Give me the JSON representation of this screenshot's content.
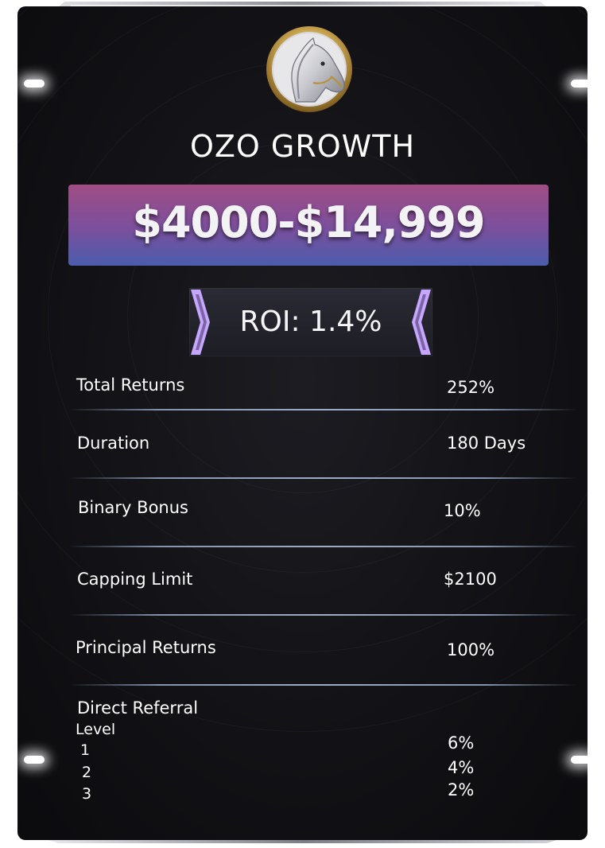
{
  "logo_alt": "horse-head-emblem",
  "title": "OZO GROWTH",
  "price_range": "$4000-$14,999",
  "roi": "ROI: 1.4%",
  "rows": [
    {
      "label": "Total Returns",
      "value": "252%"
    },
    {
      "label": "Duration",
      "value": "180 Days"
    },
    {
      "label": "Binary Bonus",
      "value": "10%"
    },
    {
      "label": "Capping Limit",
      "value": "$2100"
    },
    {
      "label": "Principal Returns",
      "value": "100%"
    }
  ],
  "referral": {
    "heading": "Direct Referral",
    "level_label": "Level",
    "levels": [
      {
        "level": "1",
        "value": "6%"
      },
      {
        "level": "2",
        "value": "4%"
      },
      {
        "level": "3",
        "value": "2%"
      }
    ]
  },
  "colors": {
    "price_gradient_top": "#a04d84",
    "price_gradient_bottom": "#4c5cad",
    "chevron_accent": "#c6a6ff",
    "card_background": "#141418"
  }
}
